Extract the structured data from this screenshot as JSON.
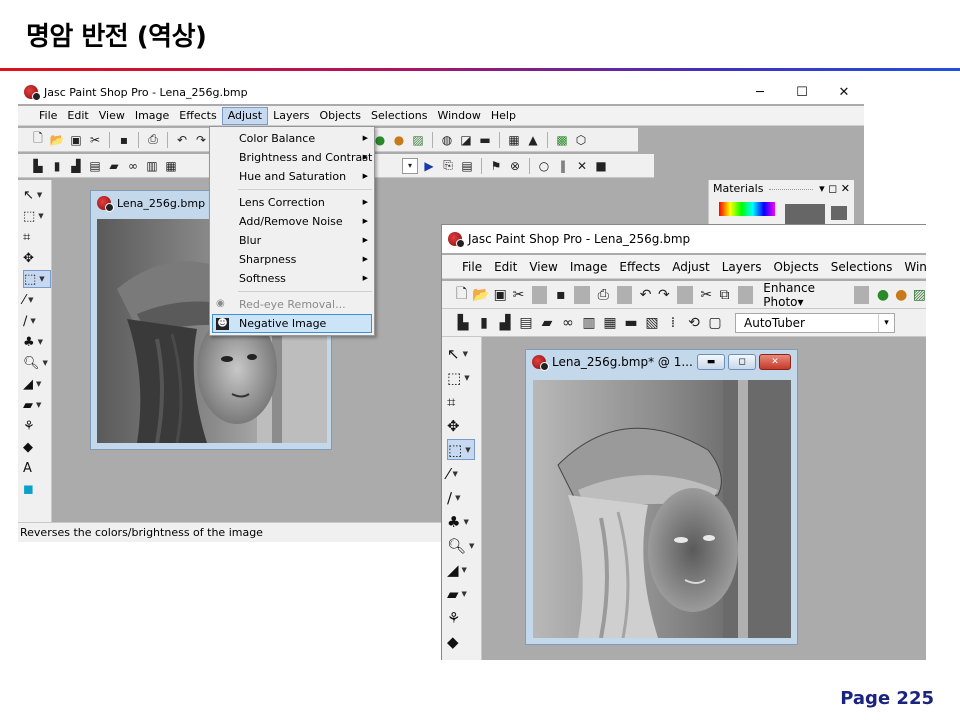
{
  "slide": {
    "title": "명암 반전 (역상)",
    "page": "Page 225"
  },
  "win1": {
    "title": "Jasc Paint Shop Pro - Lena_256g.bmp",
    "controls": [
      "─",
      "☐",
      "✕"
    ],
    "menus": [
      "File",
      "Edit",
      "View",
      "Image",
      "Effects",
      "Adjust",
      "Layers",
      "Objects",
      "Selections",
      "Window",
      "Help"
    ],
    "active_menu": "Adjust",
    "image_window_title": "Lena_256g.bmp @",
    "status": "Reverses the colors/brightness of the image",
    "materials_title": "Materials",
    "dropdown": [
      {
        "label": "Color Balance",
        "submenu": true
      },
      {
        "label": "Brightness and Contrast",
        "submenu": true
      },
      {
        "label": "Hue and Saturation",
        "submenu": true
      },
      {
        "label": "Lens Correction",
        "submenu": true
      },
      {
        "label": "Add/Remove Noise",
        "submenu": true
      },
      {
        "label": "Blur",
        "submenu": true
      },
      {
        "label": "Sharpness",
        "submenu": true
      },
      {
        "label": "Softness",
        "submenu": true
      },
      {
        "label": "Red-eye Removal...",
        "submenu": false,
        "disabled": true
      },
      {
        "label": "Negative Image",
        "submenu": false,
        "highlighted": true
      }
    ]
  },
  "win2": {
    "title": "Jasc Paint Shop Pro - Lena_256g.bmp",
    "menus": [
      "File",
      "Edit",
      "View",
      "Image",
      "Effects",
      "Adjust",
      "Layers",
      "Objects",
      "Selections",
      "Window"
    ],
    "enhance_photo": "Enhance Photo",
    "autotuber": "AutoTuber",
    "image_window_title": "Lena_256g.bmp* @ 1..."
  },
  "colors": {
    "workspace": "#ababab",
    "highlight": "#cce4f7",
    "page_number": "#1a237e"
  }
}
